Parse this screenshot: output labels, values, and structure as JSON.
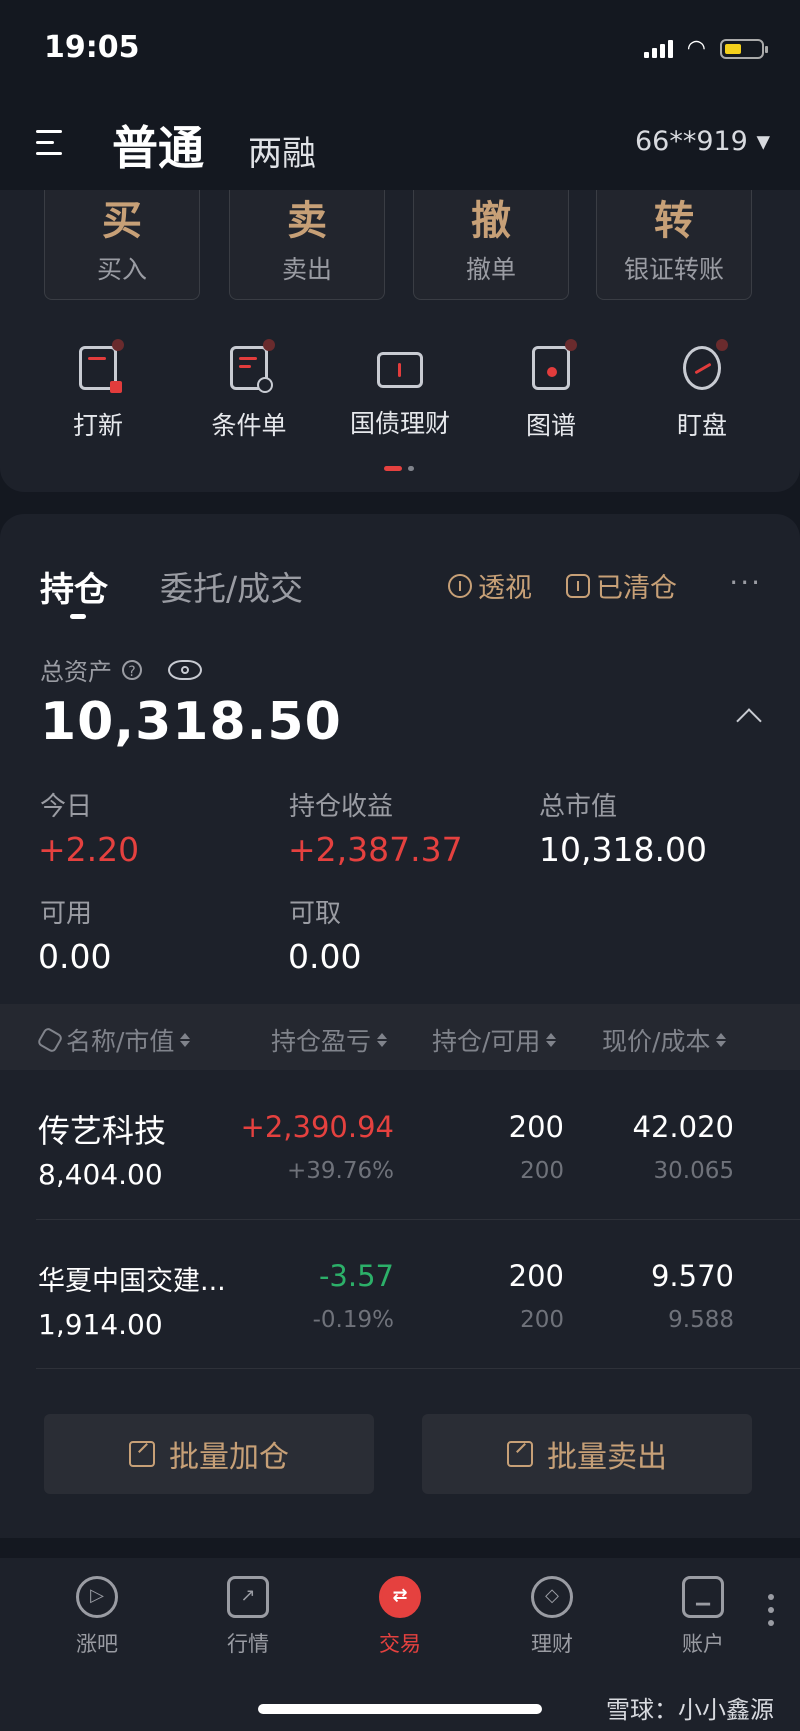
{
  "status": {
    "time": "19:05"
  },
  "header": {
    "tab_normal": "普通",
    "tab_margin": "两融",
    "account": "66**919 ▾"
  },
  "quick_actions": [
    {
      "big": "买",
      "label": "买入"
    },
    {
      "big": "卖",
      "label": "卖出"
    },
    {
      "big": "撤",
      "label": "撤单"
    },
    {
      "big": "转",
      "label": "银证转账"
    }
  ],
  "tools": [
    {
      "label": "打新",
      "icon": "ipo-ticket-icon"
    },
    {
      "label": "条件单",
      "icon": "conditional-order-icon"
    },
    {
      "label": "国债理财",
      "icon": "treasury-bond-icon"
    },
    {
      "label": "图谱",
      "icon": "graph-map-icon"
    },
    {
      "label": "盯盘",
      "icon": "watch-market-icon"
    }
  ],
  "holdings": {
    "tab_holdings": "持仓",
    "tab_orders": "委托/成交",
    "action_perspective": "透视",
    "action_cleared": "已清仓",
    "more": "···",
    "total_assets_label": "总资产",
    "total_assets": "10,318.50",
    "stats": {
      "today_label": "今日",
      "today": "+2.20",
      "pnl_label": "持仓收益",
      "pnl": "+2,387.37",
      "mv_label": "总市值",
      "mv": "10,318.00",
      "avail_label": "可用",
      "avail": "0.00",
      "withdraw_label": "可取",
      "withdraw": "0.00"
    },
    "columns": [
      "名称/市值",
      "持仓盈亏",
      "持仓/可用",
      "现价/成本"
    ],
    "rows": [
      {
        "name": "传艺科技",
        "market_value": "8,404.00",
        "pnl": "+2,390.94",
        "pnl_pct": "+39.76%",
        "qty": "200",
        "avail": "200",
        "price": "42.020",
        "cost": "30.065"
      },
      {
        "name": "华夏中国交建...",
        "market_value": "1,914.00",
        "pnl": "-3.57",
        "pnl_pct": "-0.19%",
        "qty": "200",
        "avail": "200",
        "price": "9.570",
        "cost": "9.588"
      }
    ],
    "batch_add": "批量加仓",
    "batch_sell": "批量卖出"
  },
  "nav": [
    {
      "label": "涨吧",
      "glyph": "▷"
    },
    {
      "label": "行情",
      "glyph": "↗"
    },
    {
      "label": "交易",
      "glyph": "⇄"
    },
    {
      "label": "理财",
      "glyph": "◇"
    },
    {
      "label": "账户",
      "glyph": "▁"
    }
  ],
  "watermark": "雪球：小小鑫源",
  "colors": {
    "accent_gold": "#c7a077",
    "up_red": "#e5413f",
    "down_green": "#2cb069",
    "background": "#141820"
  }
}
